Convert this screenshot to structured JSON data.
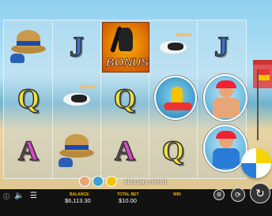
{
  "game": {
    "bonus_label": "BONUS",
    "mixed_pay_text": "also pay mixed"
  },
  "reels": [
    [
      "hat-symbol",
      "q-symbol",
      "a-symbol"
    ],
    [
      "j-symbol",
      "pelican-symbol",
      "hat-symbol"
    ],
    [
      "bonus-symbol",
      "q-symbol",
      "a-symbol"
    ],
    [
      "pelican-symbol",
      "jetski-symbol",
      "q-symbol"
    ],
    [
      "j-symbol",
      "lifeguard-symbol",
      "lifeguard-symbol"
    ]
  ],
  "letters": {
    "j": "J",
    "q": "Q",
    "a": "A"
  },
  "bottom_bar": {
    "balance_label": "BALANCE",
    "balance_value": "$6,113.30",
    "total_bet_label": "TOTAL BET",
    "total_bet_value": "$10.00",
    "win_label": "WIN",
    "win_value": ""
  },
  "colors": {
    "label_gold": "#f0b500",
    "bar_background": "#121212"
  }
}
